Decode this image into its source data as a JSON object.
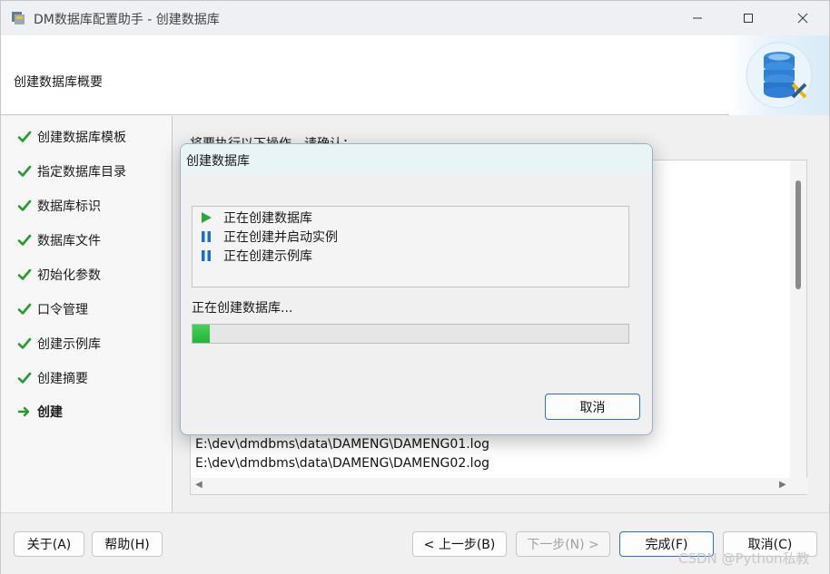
{
  "window": {
    "title": "DM数据库配置助手 - 创建数据库",
    "minimize_icon": "minimize-icon",
    "maximize_icon": "maximize-icon",
    "close_icon": "close-icon"
  },
  "header": {
    "title": "创建数据库概要",
    "logo_icon": "database-tools-icon"
  },
  "nav": {
    "items": [
      {
        "label": "创建数据库模板",
        "status": "done",
        "icon": "checkmark-icon"
      },
      {
        "label": "指定数据库目录",
        "status": "done",
        "icon": "checkmark-icon"
      },
      {
        "label": "数据库标识",
        "status": "done",
        "icon": "checkmark-icon"
      },
      {
        "label": "数据库文件",
        "status": "done",
        "icon": "checkmark-icon"
      },
      {
        "label": "初始化参数",
        "status": "done",
        "icon": "checkmark-icon"
      },
      {
        "label": "口令管理",
        "status": "done",
        "icon": "checkmark-icon"
      },
      {
        "label": "创建示例库",
        "status": "done",
        "icon": "checkmark-icon"
      },
      {
        "label": "创建摘要",
        "status": "done",
        "icon": "checkmark-icon"
      },
      {
        "label": "创建",
        "status": "current",
        "icon": "arrow-right-icon"
      }
    ]
  },
  "main": {
    "confirm_label": "将要执行以下操作，请确认：",
    "summary_lines": [
      "E:\\dev\\dmdbms\\data\\DAMENG\\DAMENG01.log",
      "E:\\dev\\dmdbms\\data\\DAMENG\\DAMENG02.log"
    ]
  },
  "dialog": {
    "title": "创建数据库",
    "tasks": [
      {
        "label": "正在创建数据库",
        "state": "running",
        "icon": "play-icon"
      },
      {
        "label": "正在创建并启动实例",
        "state": "paused",
        "icon": "pause-icon"
      },
      {
        "label": "正在创建示例库",
        "state": "paused",
        "icon": "pause-icon"
      }
    ],
    "progress_label": "正在创建数据库...",
    "progress": 0.04,
    "cancel_label": "取消"
  },
  "footer": {
    "about_label": "关于(A)",
    "help_label": "帮助(H)",
    "prev_label": "< 上一步(B)",
    "next_label": "下一步(N) >",
    "finish_label": "完成(F)",
    "cancel_label": "取消(C)"
  },
  "watermark": "CSDN @Python私教",
  "colors": {
    "check": "#1f9e2a",
    "progress": "#2bbf3e",
    "play": "#2aa838",
    "pause": "#1f6fc0",
    "accent_border": "#2a73c3"
  }
}
